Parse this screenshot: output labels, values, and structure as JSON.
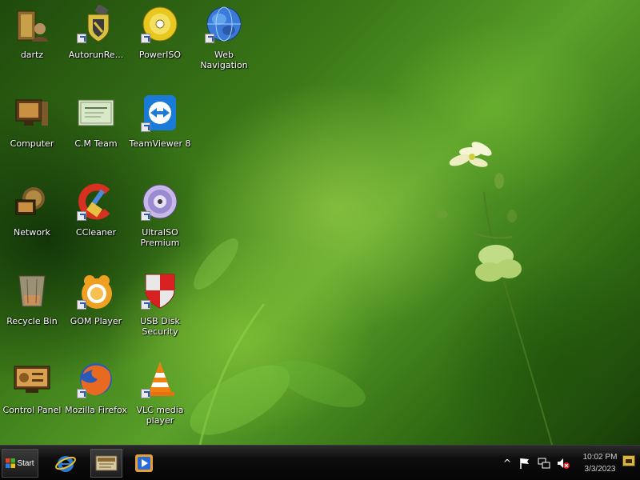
{
  "desktop": {
    "icons": [
      {
        "label": "dartz",
        "icon": "user-folder-icon",
        "shortcut": false
      },
      {
        "label": "Computer",
        "icon": "computer-icon",
        "shortcut": false
      },
      {
        "label": "Network",
        "icon": "network-icon",
        "shortcut": false
      },
      {
        "label": "Recycle Bin",
        "icon": "recycle-bin-icon",
        "shortcut": false
      },
      {
        "label": "Control Panel",
        "icon": "control-panel-icon",
        "shortcut": false
      },
      {
        "label": "AutorunRe...",
        "icon": "usb-shield-icon",
        "shortcut": true
      },
      {
        "label": "C.M Team",
        "icon": "certificate-icon",
        "shortcut": false
      },
      {
        "label": "CCleaner",
        "icon": "ccleaner-icon",
        "shortcut": true
      },
      {
        "label": "GOM Player",
        "icon": "gom-player-icon",
        "shortcut": true
      },
      {
        "label": "Mozilla Firefox",
        "icon": "firefox-icon",
        "shortcut": true
      },
      {
        "label": "PowerISO",
        "icon": "poweriso-disc-icon",
        "shortcut": true
      },
      {
        "label": "TeamViewer 8",
        "icon": "teamviewer-icon",
        "shortcut": true
      },
      {
        "label": "UltraISO\nPremium",
        "icon": "ultraiso-disc-icon",
        "shortcut": true
      },
      {
        "label": "USB Disk\nSecurity",
        "icon": "usb-disk-security-icon",
        "shortcut": true
      },
      {
        "label": "VLC media\nplayer",
        "icon": "vlc-cone-icon",
        "shortcut": true
      },
      {
        "label": "Web\nNavigation",
        "icon": "globe-icon",
        "shortcut": true
      }
    ]
  },
  "taskbar": {
    "start_label": "Start",
    "quick_launch": [
      {
        "icon": "internet-explorer-icon",
        "active": false
      },
      {
        "icon": "certificate-window-icon",
        "active": true
      },
      {
        "icon": "media-player-icon",
        "active": false
      }
    ],
    "tray": {
      "icons": [
        "chevron-up-icon",
        "flag-icon",
        "network-tray-icon",
        "volume-muted-icon"
      ],
      "time": "10:02 PM",
      "date": "3/3/2023"
    }
  },
  "colors": {
    "wallpaper_accent": "#5aa02a",
    "taskbar_bg": "#0c0c0c",
    "label_text": "#ffffff"
  }
}
